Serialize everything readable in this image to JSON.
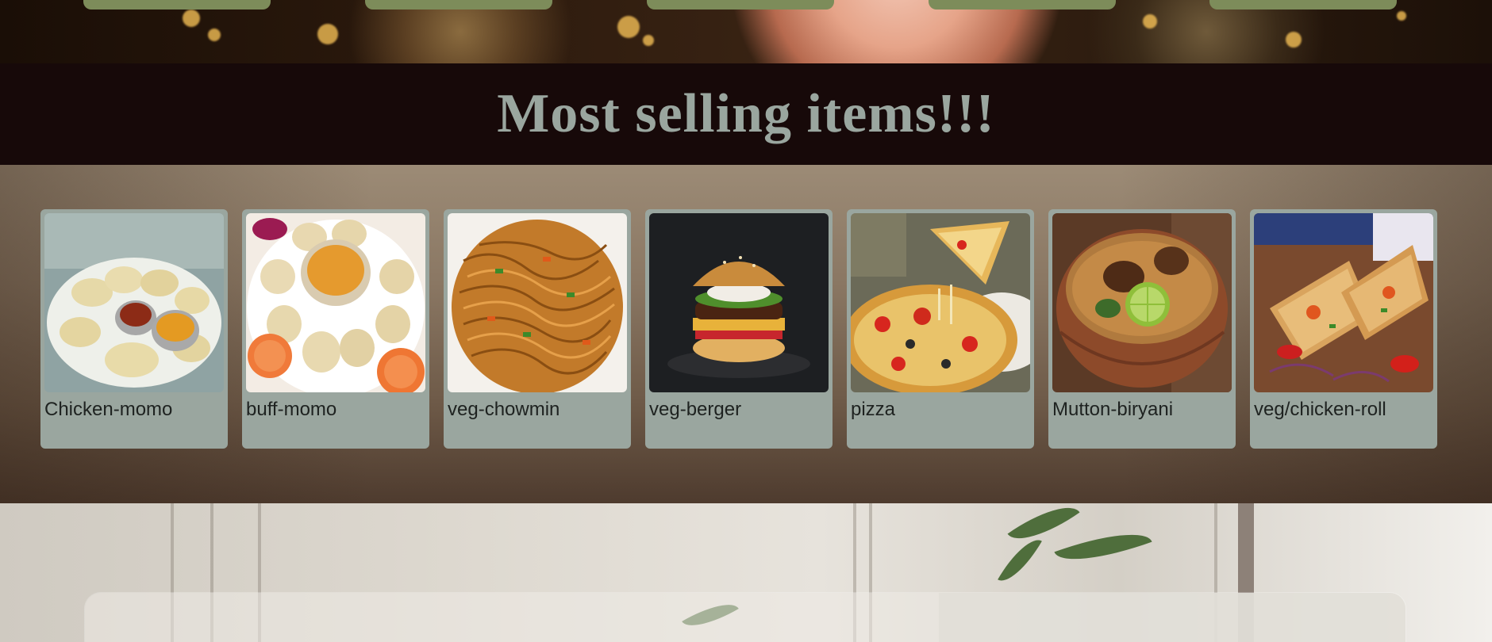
{
  "section": {
    "title": "Most selling items!!!"
  },
  "items": [
    {
      "label": "Chicken-momo",
      "icon": "momo-plate-image"
    },
    {
      "label": "buff-momo",
      "icon": "momo-bowl-image"
    },
    {
      "label": "veg-chowmin",
      "icon": "noodles-image"
    },
    {
      "label": "veg-berger",
      "icon": "burger-image"
    },
    {
      "label": "pizza",
      "icon": "pizza-image"
    },
    {
      "label": "Mutton-biryani",
      "icon": "biryani-image"
    },
    {
      "label": "veg/chicken-roll",
      "icon": "roll-image"
    }
  ],
  "colors": {
    "title_band": "#170909",
    "title_text": "#9aa69f",
    "card_bg": "#9aa69f",
    "nav_button": "#7d8c5a"
  }
}
